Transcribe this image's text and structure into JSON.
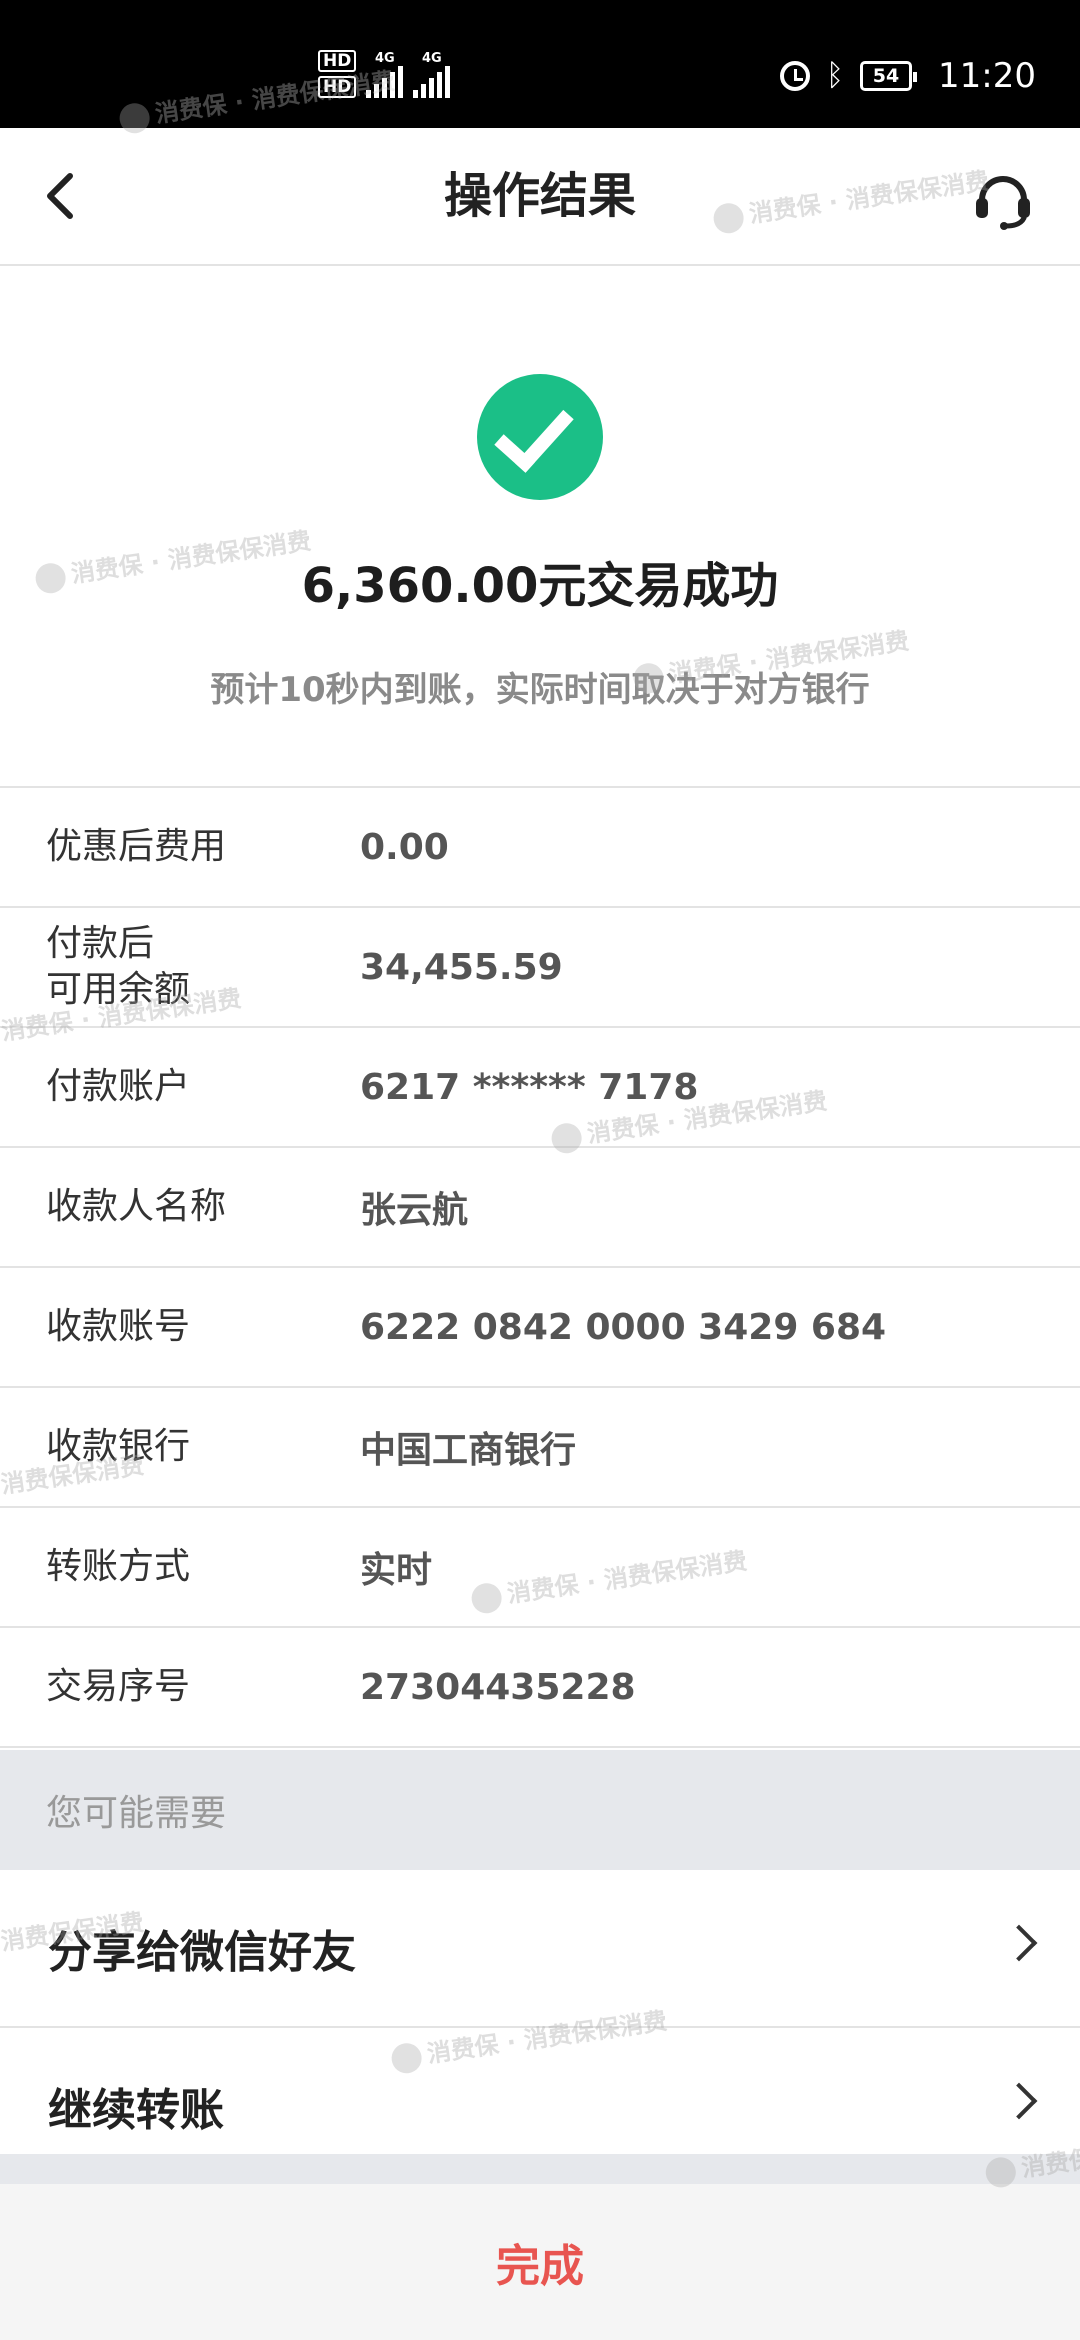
{
  "status_bar": {
    "hd1": "HD",
    "hd2": "HD",
    "net1": "4G",
    "net2": "4G",
    "battery": "54",
    "time": "11:20"
  },
  "header": {
    "title": "操作结果"
  },
  "result": {
    "amount_text": "6,360.00元交易成功",
    "eta_text": "预计10秒内到账，实际时间取决于对方银行",
    "accent_color": "#1bbf87"
  },
  "details": [
    {
      "label": "优惠后费用",
      "value": "0.00"
    },
    {
      "label_line1": "付款后",
      "label_line2": "可用余额",
      "value": "34,455.59"
    },
    {
      "label": "付款账户",
      "value": "6217 ****** 7178"
    },
    {
      "label": "收款人名称",
      "value": "张云航"
    },
    {
      "label": "收款账号",
      "value": "6222 0842 0000 3429 684"
    },
    {
      "label": "收款银行",
      "value": "中国工商银行"
    },
    {
      "label": "转账方式",
      "value": "实时"
    },
    {
      "label": "交易序号",
      "value": "27304435228"
    }
  ],
  "suggestions": {
    "title": "您可能需要",
    "items": [
      {
        "label": "分享给微信好友"
      },
      {
        "label": "继续转账"
      }
    ]
  },
  "footer": {
    "done_label": "完成",
    "done_color": "#e85550"
  },
  "watermark": {
    "brand": "消费保",
    "text": "消费保保消费"
  }
}
